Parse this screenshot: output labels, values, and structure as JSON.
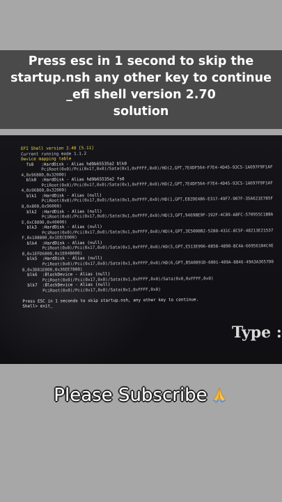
{
  "banner": {
    "line1": "Press esc in 1 second to skip the",
    "line2": "startup.nsh any other key to continue",
    "line3": "_efi shell version 2.70",
    "line4": "solution"
  },
  "terminal": {
    "lines": [
      {
        "t": "EFI Shell version 2.40 [5.11]",
        "c": "y"
      },
      {
        "t": "Current running mode 1.1.2",
        "c": "b"
      },
      {
        "t": "Device mapping table",
        "c": "y"
      },
      {
        "t": "  fs0   :HardDisk - Alias hd9b65535a2 blk0",
        "c": "w"
      },
      {
        "t": "        PciRoot(0x0)/Pci(0x17,0x0)/Sata(0x1,0xFFFF,0x0)/HD(2,GPT,7E4DF564-F7E4-4D45-93C5-1A697F9F1AF",
        "c": "b"
      },
      {
        "t": "4,0x96800,0x32000)",
        "c": "b"
      },
      {
        "t": "  blk0  :HardDisk - Alias hd9b65535a2 fs0",
        "c": "w"
      },
      {
        "t": "        PciRoot(0x0)/Pci(0x17,0x0)/Sata(0x1,0xFFFF,0x0)/HD(2,GPT,7E4DF564-F7E4-4D45-93C5-1A697F9F1AF",
        "c": "b"
      },
      {
        "t": "4,0x96800,0x32000)",
        "c": "b"
      },
      {
        "t": "  blk1  :HardDisk - Alias (null)",
        "c": "w"
      },
      {
        "t": "        PciRoot(0x0)/Pci(0x17,0x0)/Sata(0x1,0xFFFF,0x0)/HD(1,GPT,E82DE486-E317-49F7-907F-35A621E785F",
        "c": "b"
      },
      {
        "t": "8,0x800,0x96000)",
        "c": "b"
      },
      {
        "t": "  blk2  :HardDisk - Alias (null)",
        "c": "w"
      },
      {
        "t": "        PciRoot(0x0)/Pci(0x17,0x0)/Sata(0x1,0xFFFF,0x0)/HD(3,GPT,94698E9F-192F-4C89-A8FC-570955C1B8A",
        "c": "b"
      },
      {
        "t": "E,0xC8800,0x40000)",
        "c": "b"
      },
      {
        "t": "  blk3  :HardDisk - Alias (null)",
        "c": "w"
      },
      {
        "t": "        PciRoot(0x0)/Pci(0x17,0x0)/Sata(0x1,0xFFFF,0x0)/HD(4,GPT,3E5000B2-5280-431C-8C5F-48213E21537",
        "c": "b"
      },
      {
        "t": "F,0x108800,0x1EECE000)",
        "c": "b"
      },
      {
        "t": "  blk4  :HardDisk - Alias (null)",
        "c": "w"
      },
      {
        "t": "        PciRoot(0x0)/Pci(0x17,0x0)/Sata(0x1,0xFFFF,0x0)/HD(5,GPT,E513E996-0858-4890-BC4A-66956104C4E",
        "c": "b"
      },
      {
        "t": "8,0x1EFD6800,0x1E048000)",
        "c": "b"
      },
      {
        "t": "  blk5  :HardDisk - Alias (null)",
        "c": "w"
      },
      {
        "t": "        PciRoot(0x0)/Pci(0x17,0x0)/Sata(0x1,0xFFFF,0x0)/HD(6,GPT,B5A0891D-6001-409A-8846-49A3A3657D0",
        "c": "b"
      },
      {
        "t": "8,0x3D81E800,0x36EE7800)",
        "c": "b"
      },
      {
        "t": "  blk6  :BlockDevice - Alias (null)",
        "c": "w"
      },
      {
        "t": "        PciRoot(0x0)/Pci(0x17,0x0)/Sata(0x1,0xFFFF,0x0)/Sata(0x0,0xFFFF,0x0)",
        "c": "b"
      },
      {
        "t": "  blk7  :BlockDevice - Alias (null)",
        "c": "w"
      },
      {
        "t": "        PciRoot(0x0)/Pci(0x17,0x0)/Sata(0x1,0xFFFF,0x0)",
        "c": "b"
      },
      {
        "t": "",
        "c": "b"
      },
      {
        "t": "Press ESC in 1 seconds to skip startup.nsh, any other key to continue.",
        "c": "w"
      },
      {
        "t": "Shell> exit_",
        "c": "w"
      }
    ]
  },
  "overlay": {
    "type_label": "Type :"
  },
  "footer": {
    "subscribe_text": "Please Subscribe",
    "icon": "folded-hands-icon"
  }
}
